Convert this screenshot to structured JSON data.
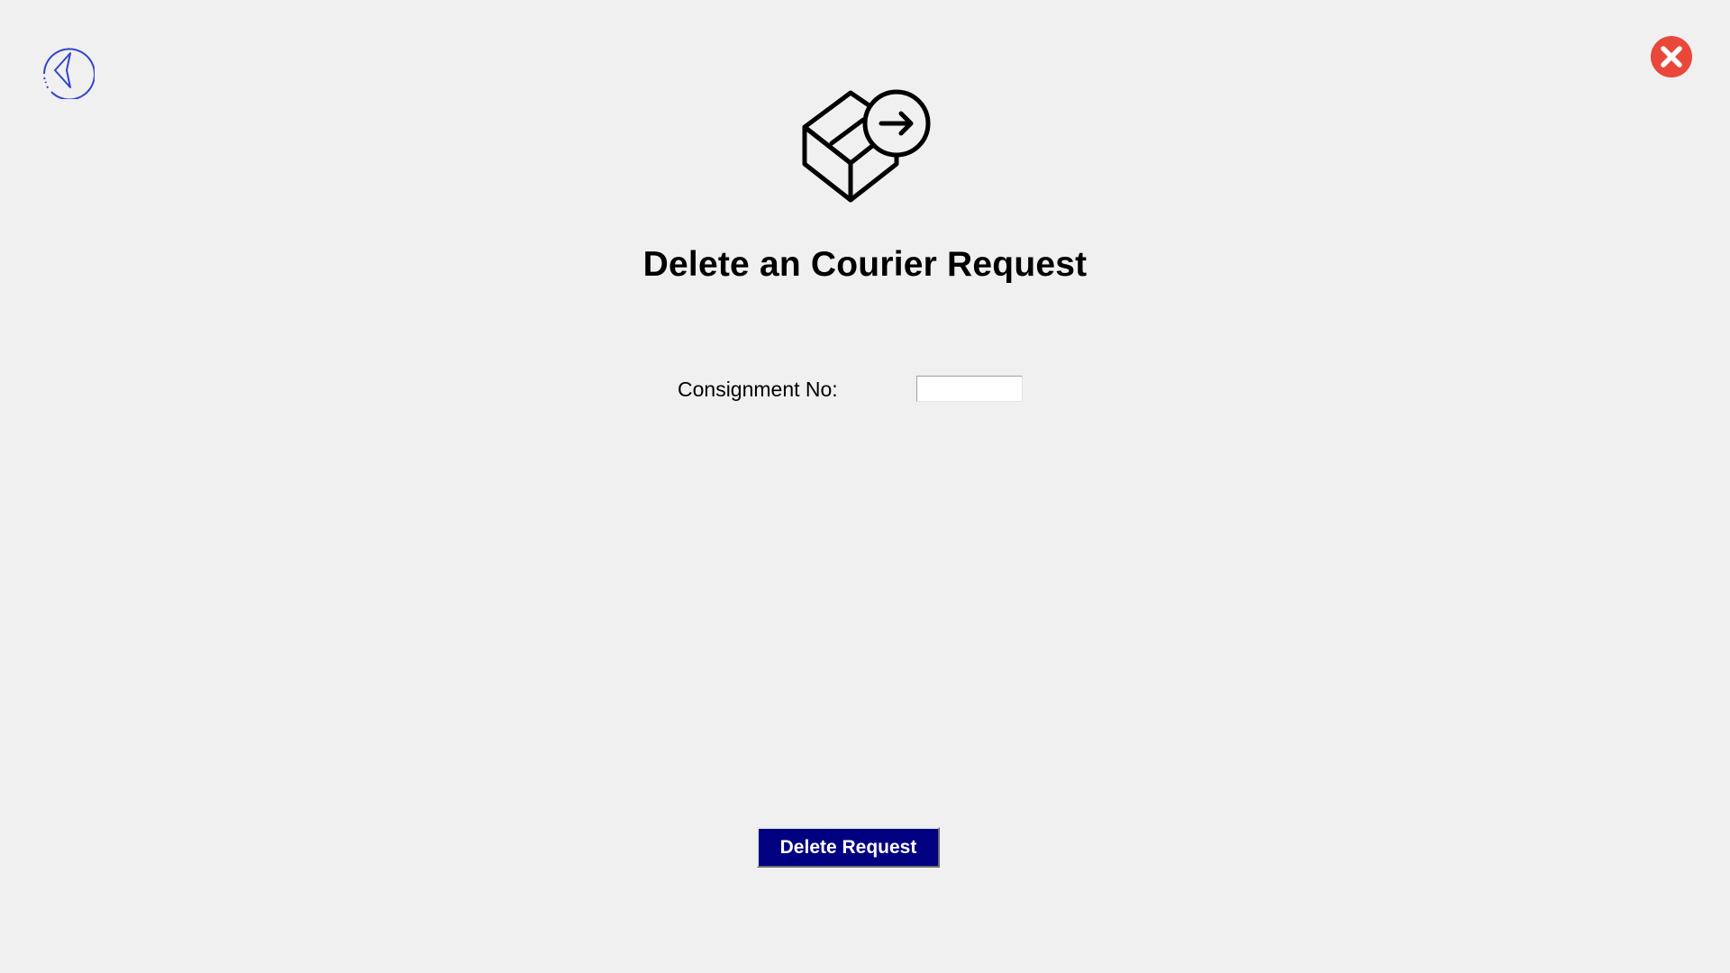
{
  "header": {
    "back_icon": "back-arrow-circle-icon",
    "close_icon": "close-circle-icon",
    "hero_icon": "package-send-icon"
  },
  "colors": {
    "background": "#f0f0f0",
    "back_icon": "#3344cc",
    "close_icon": "#e8473a",
    "button_bg": "#000080",
    "button_text": "#ffffff"
  },
  "main": {
    "title": "Delete an Courier Request",
    "consignment_label": "Consignment No:",
    "consignment_value": "",
    "delete_button_label": "Delete Request"
  }
}
